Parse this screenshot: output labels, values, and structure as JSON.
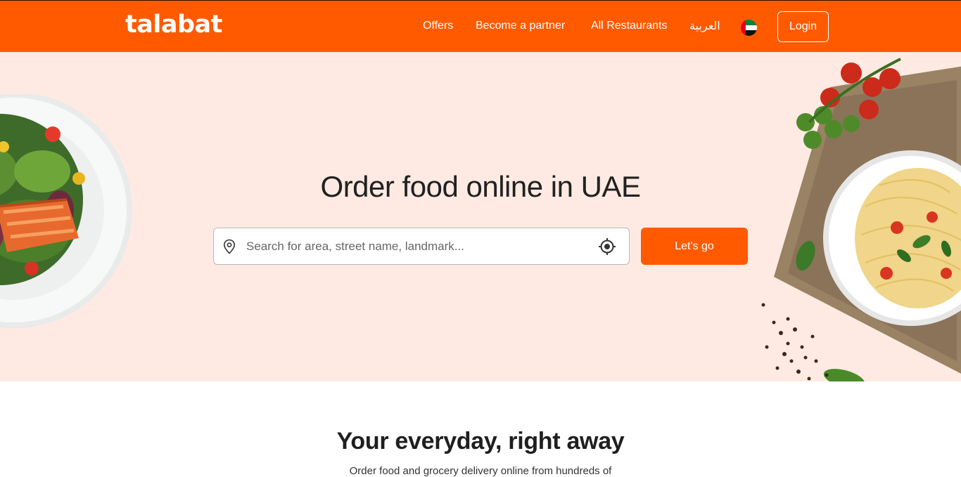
{
  "header": {
    "logo": "talabat",
    "nav": {
      "offers": "Offers",
      "partner": "Become a partner",
      "restaurants": "All Restaurants",
      "language": "العربية"
    },
    "flag_icon": "uae-flag-icon",
    "login": "Login"
  },
  "hero": {
    "title": "Order food online in UAE",
    "search_placeholder": "Search for area, street name, landmark...",
    "search_value": "",
    "pin_icon": "location-pin-icon",
    "locate_icon": "crosshair-locate-icon",
    "go_label": "Let's go"
  },
  "section": {
    "title": "Your everyday, right away",
    "subtitle": "Order food and grocery delivery online from hundreds of"
  },
  "colors": {
    "brand": "#ff5a00",
    "hero_bg": "#feeae2",
    "text_dark": "#212121"
  }
}
